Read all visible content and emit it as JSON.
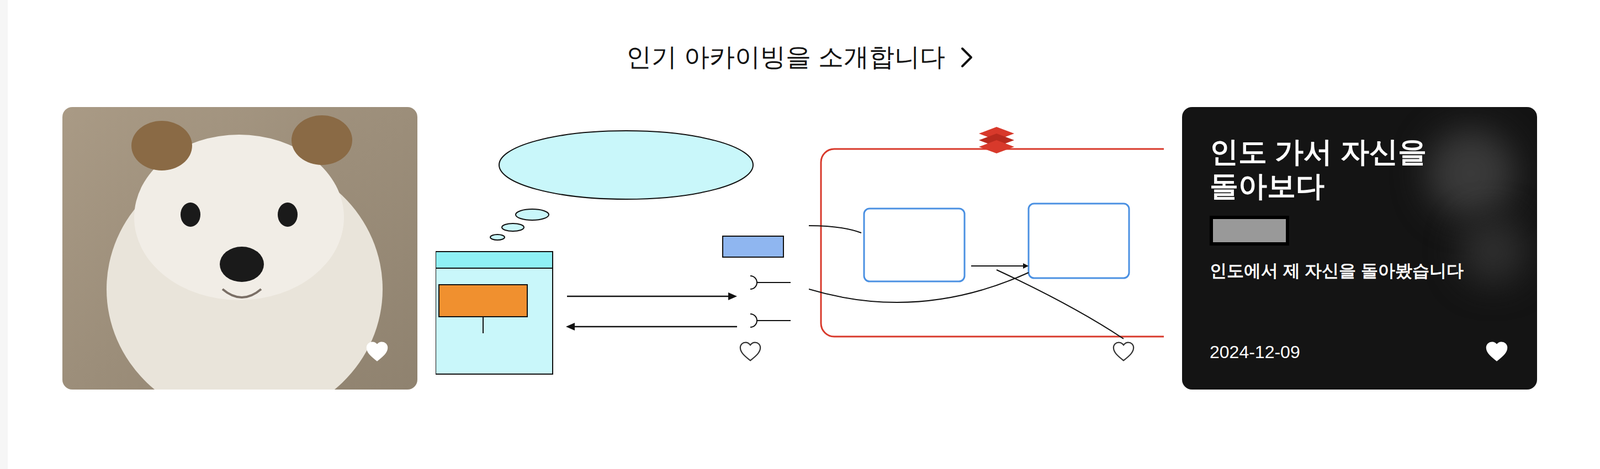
{
  "section": {
    "title": "인기 아카이빙을 소개합니다"
  },
  "cards": [
    {
      "kind": "photo"
    },
    {
      "kind": "flow"
    },
    {
      "kind": "queue"
    },
    {
      "kind": "text",
      "title": "인도 가서 자신을 돌아보다",
      "description": "인도에서 제 자신을 돌아봤습니다",
      "date": "2024-12-09"
    }
  ]
}
